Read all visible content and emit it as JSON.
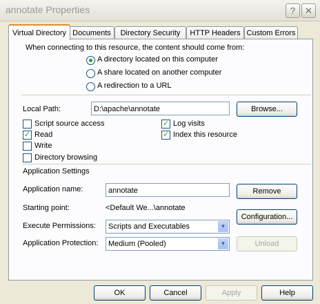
{
  "window": {
    "title": "annotate Properties",
    "help_glyph": "?",
    "close_glyph": "✕"
  },
  "tabs": [
    {
      "label": "Virtual Directory",
      "active": true
    },
    {
      "label": "Documents"
    },
    {
      "label": "Directory Security"
    },
    {
      "label": "HTTP Headers"
    },
    {
      "label": "Custom Errors"
    }
  ],
  "content_source": {
    "prompt": "When connecting to this resource, the content should come from:",
    "options": [
      {
        "label": "A directory located on this computer",
        "selected": true
      },
      {
        "label": "A share located on another computer",
        "selected": false
      },
      {
        "label": "A redirection to a URL",
        "selected": false
      }
    ]
  },
  "local_path": {
    "label": "Local Path:",
    "value": "D:\\apache\\annotate",
    "browse_label": "Browse..."
  },
  "checkboxes": {
    "script_source_access": {
      "label": "Script source access",
      "checked": false
    },
    "read": {
      "label": "Read",
      "checked": true
    },
    "write": {
      "label": "Write",
      "checked": false
    },
    "directory_browsing": {
      "label": "Directory browsing",
      "checked": false
    },
    "log_visits": {
      "label": "Log visits",
      "checked": true
    },
    "index_resource": {
      "label": "Index this resource",
      "checked": true
    }
  },
  "app_settings": {
    "header": "Application Settings",
    "name_label": "Application name:",
    "name_value": "annotate",
    "remove_label": "Remove",
    "starting_point_label": "Starting point:",
    "starting_point_value": "<Default We...\\annotate",
    "configuration_label": "Configuration...",
    "exec_label": "Execute Permissions:",
    "exec_value": "Scripts and Executables",
    "protection_label": "Application Protection:",
    "protection_value": "Medium (Pooled)",
    "unload_label": "Unload"
  },
  "footer": {
    "ok": "OK",
    "cancel": "Cancel",
    "apply": "Apply",
    "help": "Help"
  },
  "check_glyph": "✓",
  "dropdown_glyph": "▼"
}
